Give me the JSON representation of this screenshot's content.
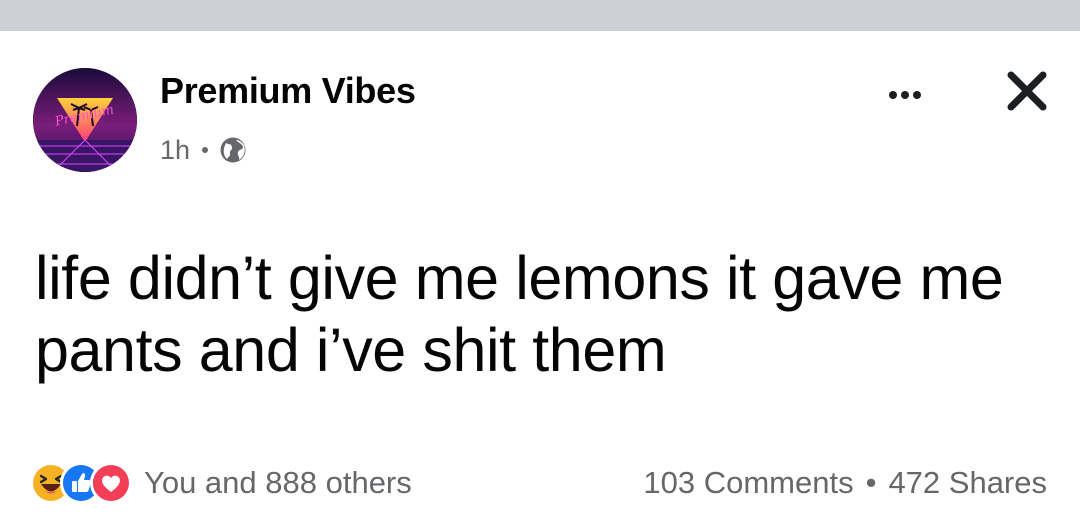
{
  "post": {
    "author": "Premium Vibes",
    "avatar_text": "Premium",
    "time": "1h",
    "audience_icon": "globe-icon",
    "text": "life didn’t give me lemons it gave me pants and i’ve shit them",
    "reactions": {
      "icons": [
        "haha-icon",
        "like-icon",
        "love-icon"
      ],
      "summary": "You and 888 others"
    },
    "comments": "103 Comments",
    "separator": "•",
    "shares": "472 Shares"
  },
  "colors": {
    "top_strip": "#cdd1d6",
    "secondary_text": "#65676b",
    "like_blue": "#1877f2",
    "love_red": "#f33e58",
    "haha_yellow": "#f7b125"
  }
}
